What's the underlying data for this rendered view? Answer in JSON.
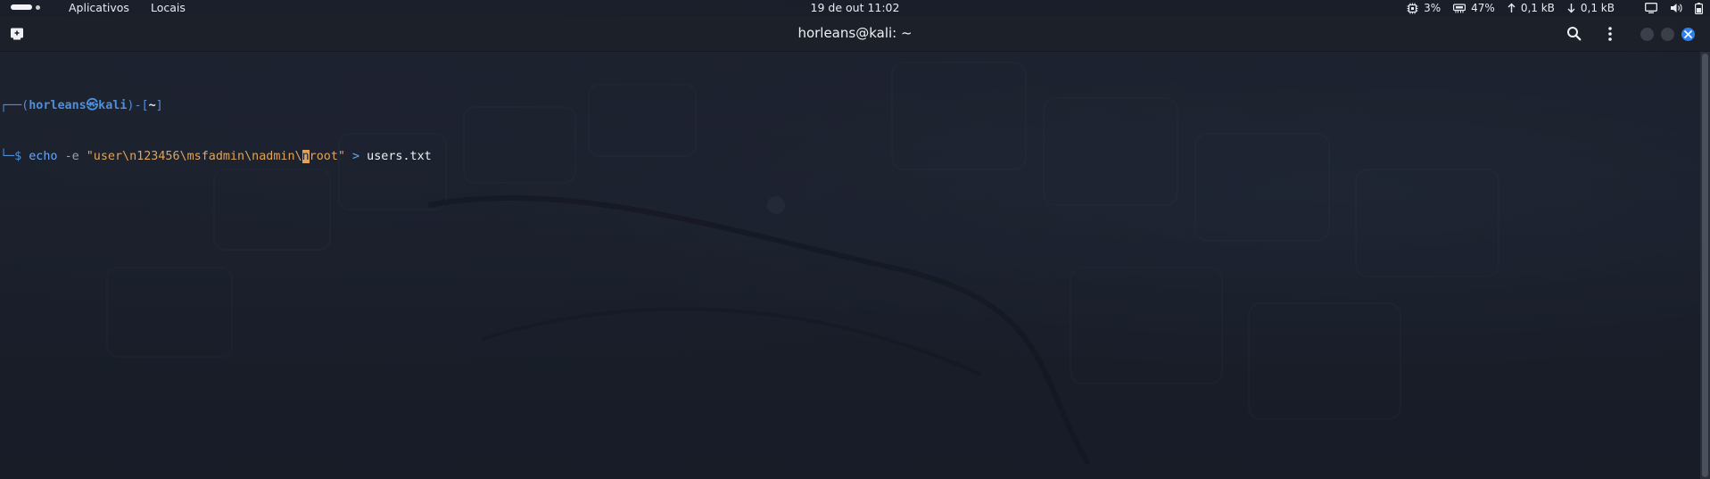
{
  "top_panel": {
    "menu": [
      "Aplicativos",
      "Locais"
    ],
    "clock": "19 de out  11:02",
    "indicators": {
      "cpu": "3%",
      "memory": "47%",
      "upload": "0,1 kB",
      "download": "0,1 kB"
    },
    "icons": [
      "activities-icon",
      "cpu-icon",
      "memory-icon",
      "upload-arrow-icon",
      "download-arrow-icon",
      "display-icon",
      "volume-icon",
      "battery-icon"
    ]
  },
  "window": {
    "title": "horleans@kali: ~",
    "buttons": [
      "new-tab",
      "search",
      "menu",
      "minimize",
      "maximize",
      "close"
    ]
  },
  "terminal": {
    "prompt": {
      "frame_top_start": "┌──(",
      "user": "horleans",
      "at": "㉿",
      "host": "kali",
      "frame_mid": ")-[",
      "path": "~",
      "frame_end": "]",
      "frame_bottom": "└─$"
    },
    "command": {
      "cmd": "echo",
      "option": "-e",
      "string_before_cursor": "\"user\\n123456\\msfadmin\\nadmin\\",
      "cursor_char": "n",
      "string_after_cursor": "root\"",
      "redirect": ">",
      "file": "users.txt"
    }
  },
  "colors": {
    "accent": "#2f80ed",
    "prompt_blue": "#4f8ed8",
    "string_orange": "#e0a35a"
  }
}
